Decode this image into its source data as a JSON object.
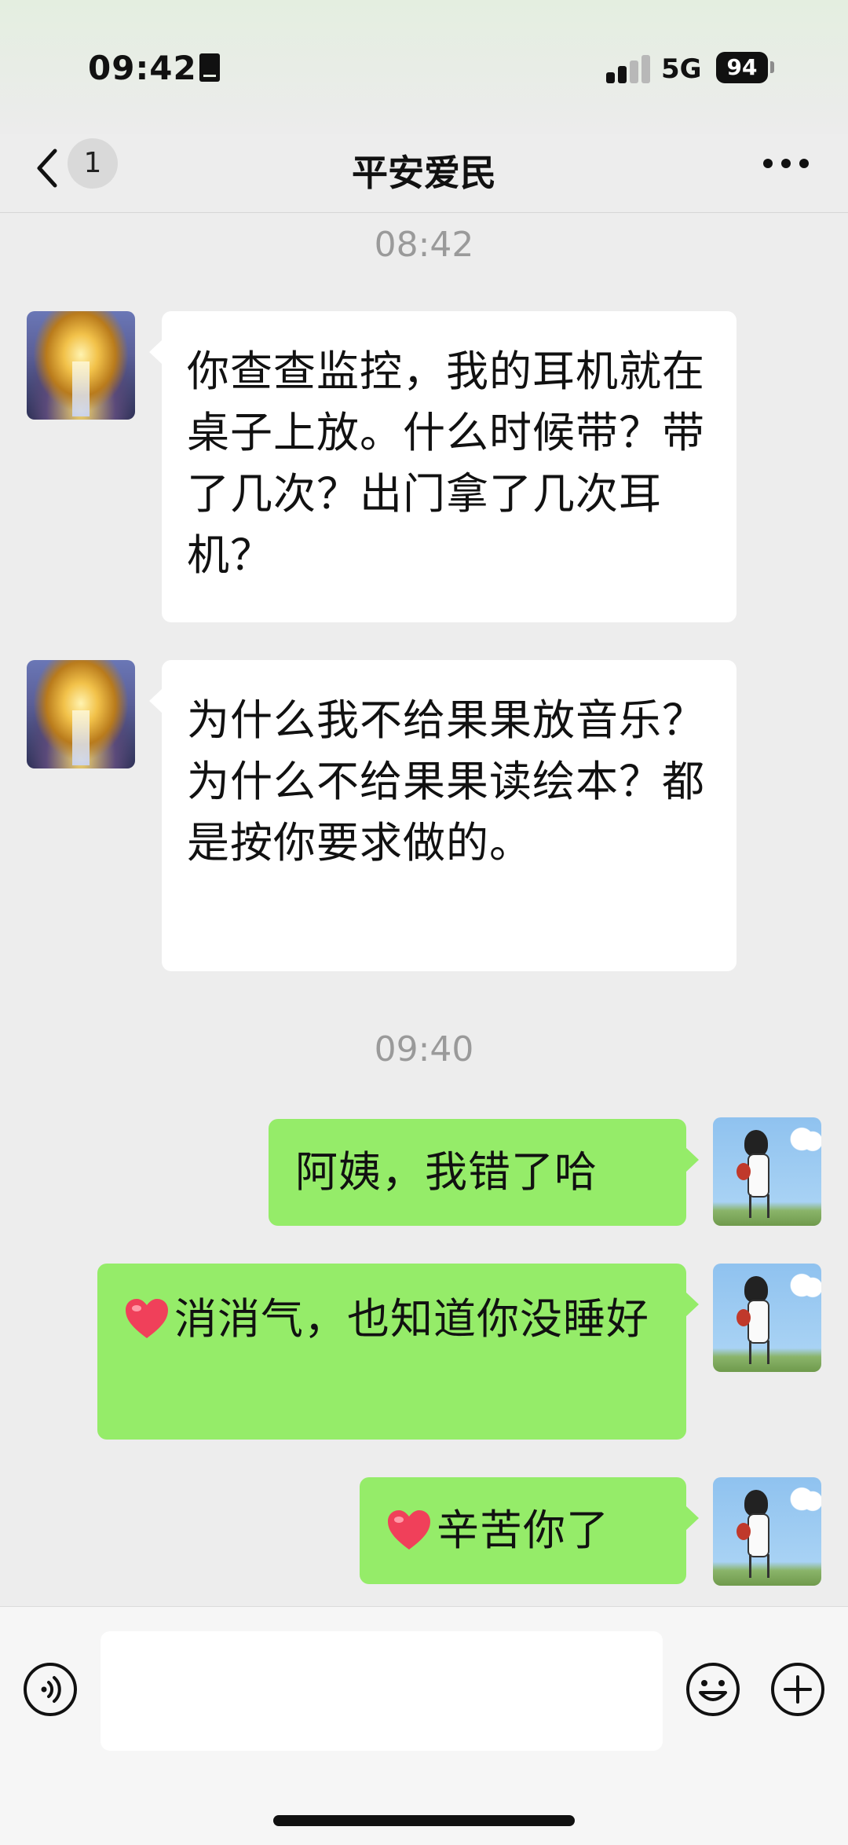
{
  "status_bar": {
    "time": "09:42",
    "network": "5G",
    "battery": "94"
  },
  "header": {
    "unread_count": "1",
    "title": "平安爱民"
  },
  "messages": [
    {
      "type": "time",
      "text": "08:42"
    },
    {
      "type": "in",
      "text": "你查查监控，我的耳机就在桌子上放。什么时候带？带了几次？出门拿了几次耳机？"
    },
    {
      "type": "in",
      "text": "为什么我不给果果放音乐？为什么不给果果读绘本？都是按你要求做的。"
    },
    {
      "type": "time",
      "text": "09:40"
    },
    {
      "type": "out",
      "text": "阿姨，我错了哈"
    },
    {
      "type": "out",
      "emoji": "red-heart",
      "text": "消消气，也知道你没睡好"
    },
    {
      "type": "out",
      "emoji": "red-heart",
      "text": "辛苦你了"
    }
  ],
  "input_bar": {
    "placeholder": ""
  },
  "colors": {
    "background": "#ededed",
    "outgoing_bubble": "#95ec69",
    "incoming_bubble": "#ffffff"
  },
  "icons": [
    "back-icon",
    "more-icon",
    "voice-icon",
    "emoji-icon",
    "plus-icon",
    "heart-icon"
  ]
}
